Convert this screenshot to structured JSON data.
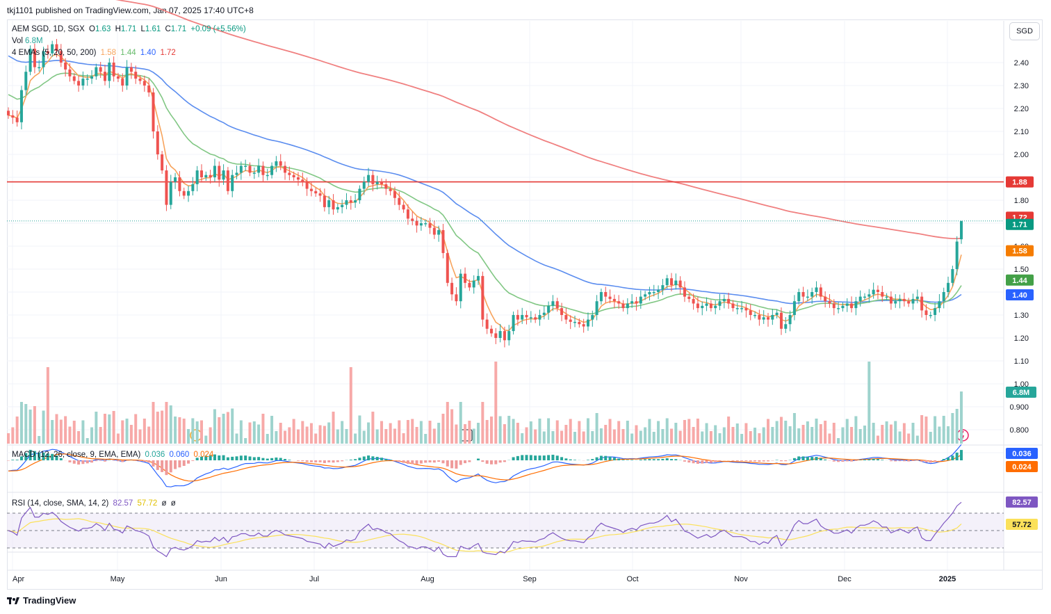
{
  "header": {
    "published": "tkj1101 published on TradingView.com, Jan 07, 2025 17:40 UTC+8"
  },
  "currency_button": "SGD",
  "footer_brand": "TradingView",
  "legend": {
    "symbol": "AEM SGD, 1D, SGX",
    "o_label": "O",
    "o_val": "1.63",
    "h_label": "H",
    "h_val": "1.71",
    "l_label": "L",
    "l_val": "1.61",
    "c_label": "C",
    "c_val": "1.71",
    "change": "+0.09 (+5.56%)",
    "vol_label": "Vol",
    "vol_val": "6.8M",
    "ema_label": "4 EMAs (5, 20, 50, 200)",
    "ema5": "1.58",
    "ema20": "1.44",
    "ema50": "1.40",
    "ema200": "1.72",
    "macd_label": "MACD (12, 26, close, 9, EMA, EMA)",
    "macd_val": "0.036",
    "signal_val": "0.060",
    "hist_val": "0.024",
    "rsi_label": "RSI (14, close, SMA, 14, 2)",
    "rsi_val": "82.57",
    "rsi_ma": "57.72",
    "rsi_x1": "ø",
    "rsi_x2": "ø"
  },
  "colors": {
    "up": "#26a69a",
    "down": "#ef5350",
    "ema5": "#f7a35c",
    "ema20": "#81c784",
    "ema50": "#5b8def",
    "ema200": "#f08080",
    "hline": "#e53935",
    "macd": "#2962ff",
    "signal": "#ff6d00",
    "rsi": "#7e57c2",
    "rsima": "#fbe15a"
  },
  "chart_data": {
    "type": "candlestick",
    "title": "AEM SGD, 1D, SGX",
    "price_axis_ticks": [
      "2.40",
      "2.30",
      "2.20",
      "2.10",
      "2.00",
      "1.80",
      "1.60",
      "1.50",
      "1.30",
      "1.20",
      "1.10",
      "1.00",
      "0.900",
      "0.800"
    ],
    "time_axis_labels": [
      "Apr",
      "May",
      "Jun",
      "Jul",
      "Aug",
      "Sep",
      "Oct",
      "Nov",
      "Dec",
      "2025"
    ],
    "horizontal_line": 1.88,
    "last": {
      "open": 1.63,
      "high": 1.71,
      "low": 1.61,
      "close": 1.71,
      "change": 0.09,
      "change_pct": 5.56,
      "volume": "6.8M"
    },
    "price_labels": [
      "1.88",
      "1.72",
      "1.71",
      "1.58",
      "1.44",
      "1.40"
    ],
    "volume_label": "6.8M",
    "closes": [
      2.17,
      2.16,
      2.14,
      2.28,
      2.36,
      2.46,
      2.38,
      2.38,
      2.45,
      2.44,
      2.48,
      2.45,
      2.4,
      2.37,
      2.34,
      2.32,
      2.3,
      2.33,
      2.33,
      2.34,
      2.38,
      2.36,
      2.32,
      2.4,
      2.34,
      2.33,
      2.3,
      2.38,
      2.36,
      2.33,
      2.32,
      2.3,
      2.27,
      2.1,
      2.0,
      1.93,
      1.78,
      1.88,
      1.9,
      1.84,
      1.82,
      1.84,
      1.87,
      1.93,
      1.9,
      1.91,
      1.9,
      1.95,
      1.89,
      1.93,
      1.84,
      1.91,
      1.92,
      1.95,
      1.95,
      1.92,
      1.92,
      1.95,
      1.91,
      1.91,
      1.95,
      1.97,
      1.95,
      1.92,
      1.91,
      1.9,
      1.89,
      1.88,
      1.85,
      1.84,
      1.83,
      1.82,
      1.77,
      1.8,
      1.76,
      1.77,
      1.78,
      1.8,
      1.79,
      1.8,
      1.85,
      1.88,
      1.91,
      1.87,
      1.88,
      1.87,
      1.85,
      1.84,
      1.81,
      1.78,
      1.76,
      1.72,
      1.71,
      1.69,
      1.7,
      1.7,
      1.68,
      1.65,
      1.67,
      1.57,
      1.44,
      1.39,
      1.36,
      1.48,
      1.44,
      1.42,
      1.45,
      1.47,
      1.28,
      1.24,
      1.22,
      1.2,
      1.23,
      1.19,
      1.23,
      1.3,
      1.28,
      1.3,
      1.29,
      1.29,
      1.28,
      1.3,
      1.31,
      1.34,
      1.36,
      1.33,
      1.3,
      1.28,
      1.27,
      1.27,
      1.26,
      1.25,
      1.28,
      1.3,
      1.36,
      1.4,
      1.38,
      1.37,
      1.36,
      1.35,
      1.33,
      1.35,
      1.36,
      1.35,
      1.38,
      1.39,
      1.4,
      1.4,
      1.41,
      1.43,
      1.46,
      1.43,
      1.45,
      1.42,
      1.38,
      1.37,
      1.35,
      1.33,
      1.34,
      1.35,
      1.33,
      1.34,
      1.36,
      1.37,
      1.35,
      1.33,
      1.33,
      1.33,
      1.32,
      1.3,
      1.3,
      1.28,
      1.29,
      1.28,
      1.3,
      1.31,
      1.24,
      1.26,
      1.3,
      1.36,
      1.4,
      1.38,
      1.38,
      1.4,
      1.42,
      1.38,
      1.36,
      1.35,
      1.33,
      1.33,
      1.34,
      1.35,
      1.33,
      1.36,
      1.38,
      1.38,
      1.39,
      1.41,
      1.4,
      1.38,
      1.38,
      1.35,
      1.36,
      1.37,
      1.36,
      1.35,
      1.37,
      1.38,
      1.32,
      1.3,
      1.3,
      1.33,
      1.36,
      1.4,
      1.44,
      1.5,
      1.62,
      1.71
    ]
  }
}
